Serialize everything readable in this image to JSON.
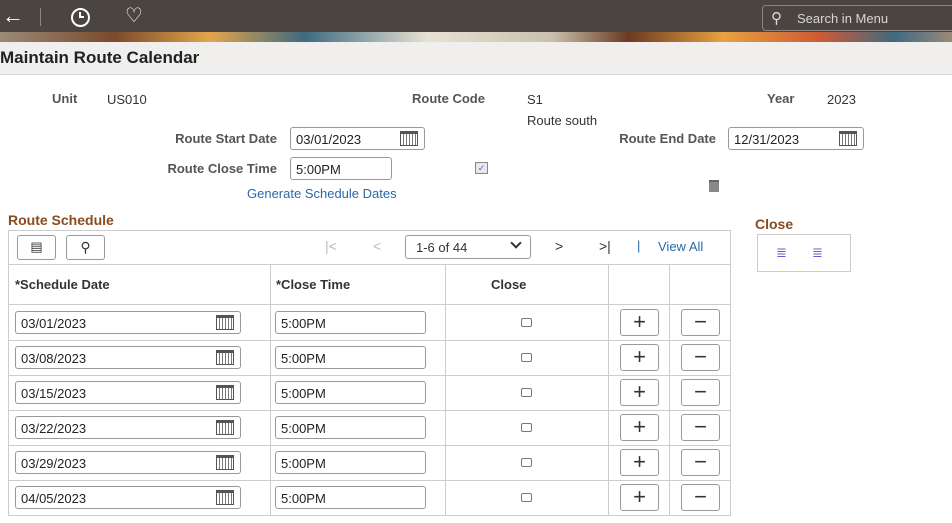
{
  "header": {
    "search_placeholder": "Search in Menu",
    "title": "Maintain Route Calendar"
  },
  "form": {
    "unit_label": "Unit",
    "unit": "US010",
    "route_code_label": "Route Code",
    "route_code": "S1",
    "route_desc": "Route south",
    "year_label": "Year",
    "year": "2023",
    "start_label": "Route Start Date",
    "start": "03/01/2023",
    "end_label": "Route End Date",
    "end": "12/31/2023",
    "close_time_label": "Route Close Time",
    "close_time": "5:00PM",
    "generate_link": "Generate Schedule Dates"
  },
  "schedule": {
    "title": "Route Schedule",
    "pager": "1-6 of 44",
    "view_all": "View All",
    "headers": [
      "*Schedule Date",
      "*Close Time",
      "Close"
    ],
    "rows": [
      {
        "date": "03/01/2023",
        "time": "5:00PM"
      },
      {
        "date": "03/08/2023",
        "time": "5:00PM"
      },
      {
        "date": "03/15/2023",
        "time": "5:00PM"
      },
      {
        "date": "03/22/2023",
        "time": "5:00PM"
      },
      {
        "date": "03/29/2023",
        "time": "5:00PM"
      },
      {
        "date": "04/05/2023",
        "time": "5:00PM"
      }
    ]
  },
  "close_panel": {
    "title": "Close"
  }
}
